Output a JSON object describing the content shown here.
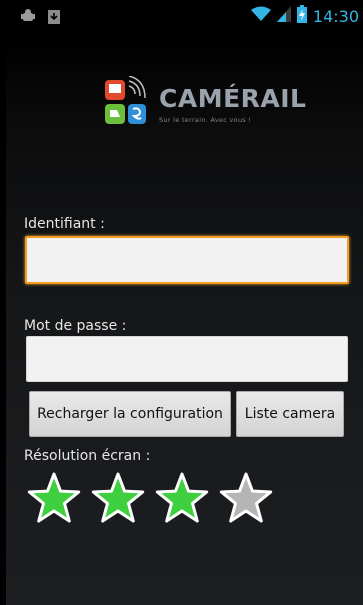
{
  "status_bar": {
    "time": "14:30",
    "icons": [
      "android-debug-icon",
      "download-icon",
      "wifi-icon",
      "signal-icon",
      "battery-charging-icon"
    ],
    "time_color": "#33b5e5"
  },
  "logo": {
    "brand": "CAMÉRAIL",
    "tagline": "Sur le terrain. Avec vous !"
  },
  "form": {
    "identifiant_label": "Identifiant :",
    "identifiant_value": "",
    "password_label": "Mot de passe :",
    "password_value": "",
    "reload_button": "Recharger la configuration",
    "camera_list_button": "Liste camera",
    "resolution_label": "Résolution écran :",
    "resolution_rating": 3,
    "resolution_max": 4
  },
  "colors": {
    "focus_border": "#f39c22",
    "star_active": "#3fcf3f",
    "star_inactive": "#b5b5b5"
  }
}
